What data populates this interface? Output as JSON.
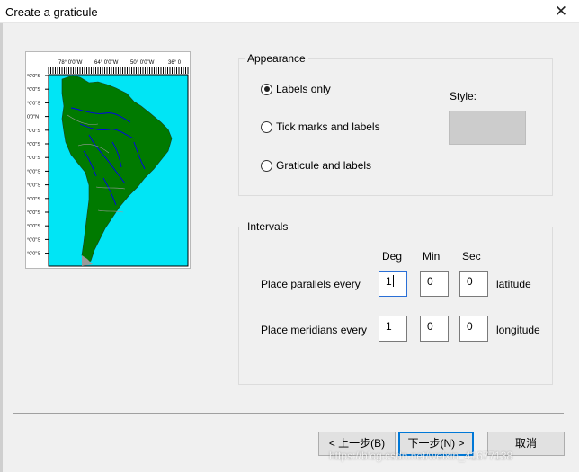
{
  "window": {
    "title": "Create a graticule",
    "close_glyph": "✕"
  },
  "preview": {
    "icon": "map-preview",
    "top_labels": [
      "78° 0'0\"W",
      "64° 0'0\"W",
      "50° 0'0\"W",
      "36° 0"
    ],
    "side_labels": [
      "°0'0\"S",
      "°0'0\"S",
      "°0'0\"S",
      "0'0\"N",
      "°0'0\"S",
      "°0'0\"S",
      "°0'0\"S",
      "°0'0\"S",
      "°0'0\"S",
      "°0'0\"S",
      "°0'0\"S",
      "°0'0\"S",
      "°0'0\"S",
      "°0'0\"S"
    ],
    "colors": {
      "ocean": "#00e5f5",
      "land": "#007a00",
      "rivers": "#0000ee",
      "borders": "#9a9a9a",
      "south": "#9a9a9a"
    }
  },
  "appearance": {
    "legend": "Appearance",
    "options": [
      {
        "label": "Labels only",
        "selected": true
      },
      {
        "label": "Tick marks and labels",
        "selected": false
      },
      {
        "label": "Graticule and labels",
        "selected": false
      }
    ],
    "style_label": "Style:",
    "style_color": "#cccccc"
  },
  "intervals": {
    "legend": "Intervals",
    "headers": {
      "deg": "Deg",
      "min": "Min",
      "sec": "Sec"
    },
    "parallels": {
      "label": "Place parallels every",
      "deg": "1",
      "min": "0",
      "sec": "0",
      "unit": "latitude"
    },
    "meridians": {
      "label": "Place meridians every",
      "deg": "1",
      "min": "0",
      "sec": "0",
      "unit": "longitude"
    }
  },
  "buttons": {
    "back": "< 上一步(B)",
    "next": "下一步(N) >",
    "cancel": "取消"
  },
  "watermark": "https://blog.csdn.net/weixin_41677138"
}
